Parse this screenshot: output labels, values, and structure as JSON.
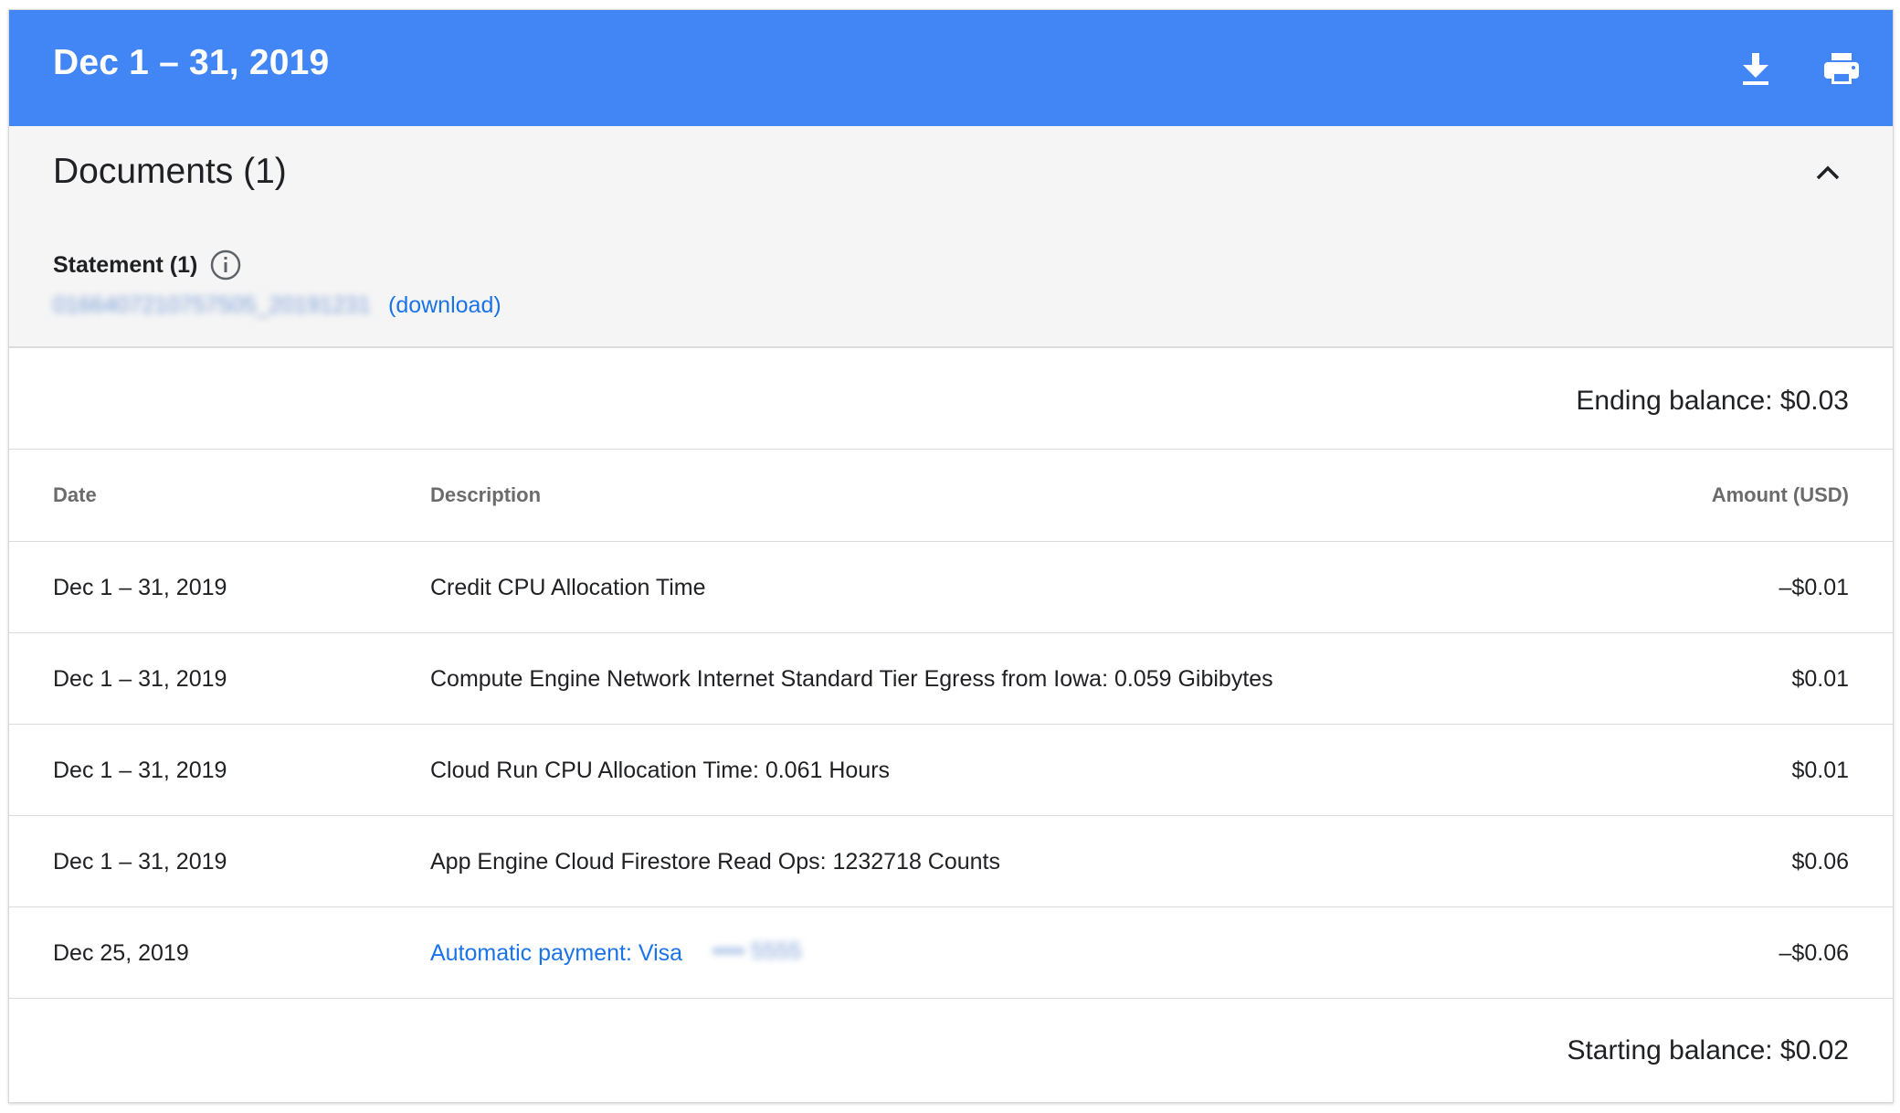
{
  "header": {
    "title": "Dec 1 – 31, 2019",
    "download_icon": "download-icon",
    "print_icon": "print-icon",
    "bg_color": "#4285f4"
  },
  "documents": {
    "title": "Documents (1)",
    "collapse_icon": "chevron-up-icon",
    "statement_label": "Statement (1)",
    "info_icon": "info-icon",
    "statement_file": "0166407210757505_20191231",
    "download_link": "(download)"
  },
  "ending_balance": "Ending balance: $0.03",
  "table": {
    "headers": {
      "date": "Date",
      "description": "Description",
      "amount": "Amount (USD)"
    },
    "rows": [
      {
        "date": "Dec 1 – 31, 2019",
        "description": "Credit CPU Allocation Time",
        "amount": "–$0.01"
      },
      {
        "date": "Dec 1 – 31, 2019",
        "description": "Compute Engine Network Internet Standard Tier Egress from Iowa: 0.059 Gibibytes",
        "amount": "$0.01"
      },
      {
        "date": "Dec 1 – 31, 2019",
        "description": "Cloud Run CPU Allocation Time: 0.061 Hours",
        "amount": "$0.01"
      },
      {
        "date": "Dec 1 – 31, 2019",
        "description": "App Engine Cloud Firestore Read Ops: 1232718 Counts",
        "amount": "$0.06"
      },
      {
        "date": "Dec 25, 2019",
        "description": "Automatic payment: Visa",
        "card_masked": "•••• 5555",
        "amount": "–$0.06"
      }
    ]
  },
  "starting_balance": "Starting balance: $0.02"
}
